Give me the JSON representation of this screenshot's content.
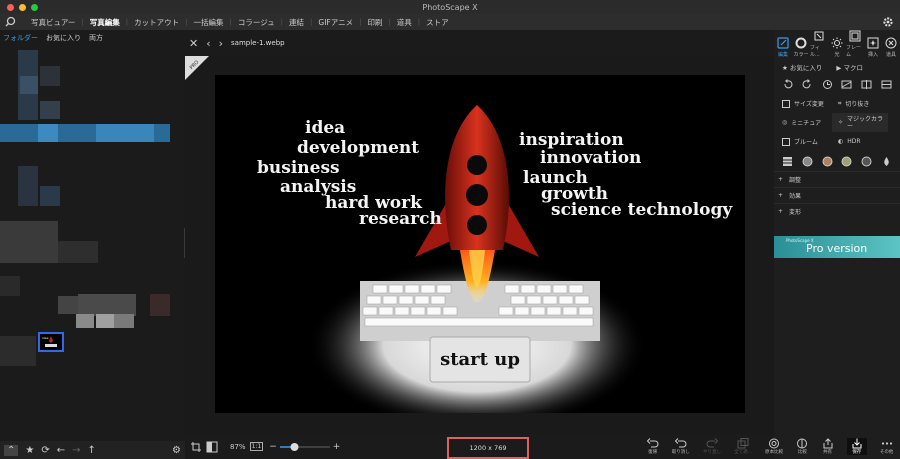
{
  "app": {
    "title": "PhotoScape X"
  },
  "menu": {
    "items": [
      "写真ビュアー",
      "写真編集",
      "カットアウト",
      "一括編集",
      "コラージュ",
      "連結",
      "GIFアニメ",
      "印刷",
      "道具",
      "ストア"
    ],
    "active_index": 1
  },
  "left_panel": {
    "tabs": [
      "フォルダー",
      "お気に入り",
      "両方"
    ],
    "active_tab": 0
  },
  "file": {
    "name": "sample-1.webp"
  },
  "image": {
    "words_left": [
      "idea",
      "development",
      "business",
      "analysis",
      "hard work",
      "research"
    ],
    "words_right": [
      "inspiration",
      "innovation",
      "launch",
      "growth",
      "science technology"
    ],
    "key_label": "start up",
    "corner_badge": "PRO"
  },
  "zoom": {
    "percent": "87%",
    "fit_label": "1:1",
    "minus": "−",
    "plus": "+",
    "slider_value": 0.25
  },
  "dimensions": "1200 x 769",
  "right_panel": {
    "tools": [
      {
        "icon": "edit-icon",
        "label": "編集"
      },
      {
        "icon": "color-icon",
        "label": "カラー"
      },
      {
        "icon": "filter-icon",
        "label": "フィル..."
      },
      {
        "icon": "light-icon",
        "label": "光"
      },
      {
        "icon": "frame-icon",
        "label": "フレーム"
      },
      {
        "icon": "insert-icon",
        "label": "挿入"
      },
      {
        "icon": "tool-icon",
        "label": "道具"
      }
    ],
    "favorites": "お気に入り",
    "macro": "マクロ",
    "buttons": [
      {
        "label": "サイズ変更"
      },
      {
        "label": "切り抜き"
      },
      {
        "label": "ミニチュア"
      },
      {
        "label": "マジックカラー"
      },
      {
        "label": "ブルーム"
      },
      {
        "label": "HDR"
      }
    ],
    "sections": [
      "調整",
      "効果",
      "変形"
    ],
    "pro_banner": {
      "small": "PhotoScape X",
      "big": "Pro version"
    }
  },
  "bottom_actions": [
    {
      "icon": "undo-icon",
      "label": "復帰"
    },
    {
      "icon": "undo2-icon",
      "label": "取り消し"
    },
    {
      "icon": "redo-icon",
      "label": "やり直し"
    },
    {
      "icon": "copy-icon",
      "label": "全て適..."
    },
    {
      "icon": "original-icon",
      "label": "原本比較"
    },
    {
      "icon": "compare-icon",
      "label": "比較"
    },
    {
      "icon": "share-icon",
      "label": "共有"
    },
    {
      "icon": "save-icon",
      "label": "保存"
    },
    {
      "icon": "more-icon",
      "label": "その他"
    }
  ],
  "colors": {
    "accent": "#3a9ce8",
    "highlight_border": "#e06060",
    "rocket": "#c0281e",
    "banner": "#2a8f96"
  }
}
